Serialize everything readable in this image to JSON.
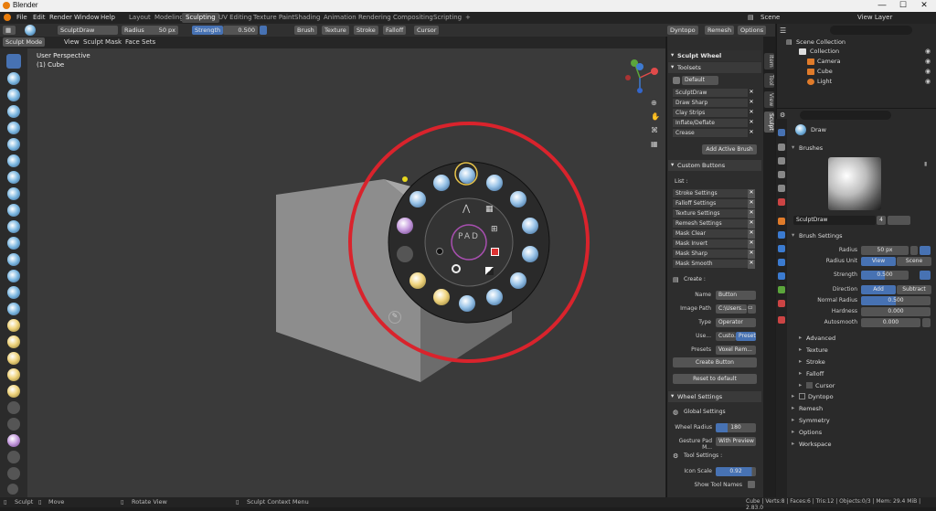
{
  "window": {
    "title": "Blender",
    "controls": [
      "—",
      "☐",
      "✕"
    ]
  },
  "menu": [
    "File",
    "Edit",
    "Render",
    "Window",
    "Help"
  ],
  "workspaces": [
    "Layout",
    "Modeling",
    "Sculpting",
    "UV Editing",
    "Texture Paint",
    "Shading",
    "Animation",
    "Rendering",
    "Compositing",
    "Scripting",
    "+"
  ],
  "active_workspace": "Sculpting",
  "scene": {
    "label": "Scene",
    "view_layer": "View Layer"
  },
  "header": {
    "brush_name": "SculptDraw",
    "radius_label": "Radius",
    "radius_value": "50 px",
    "strength_label": "Strength",
    "strength_value": "0.500",
    "dropdowns": [
      "Brush",
      "Texture",
      "Stroke",
      "Falloff",
      "Cursor"
    ],
    "dyntopo": "Dyntopo",
    "remesh": "Remesh",
    "options": "Options"
  },
  "subheader": {
    "mode": "Sculpt Mode",
    "items": [
      "View",
      "Sculpt",
      "Mask",
      "Face Sets"
    ]
  },
  "viewport": {
    "perspective": "User Perspective",
    "object": "(1) Cube",
    "pad_label": "PAD"
  },
  "sidebar_tabs": [
    "Item",
    "Tool",
    "View",
    "Sculpt"
  ],
  "sculpt_wheel": {
    "title": "Sculpt Wheel",
    "toolsets_label": "Toolsets",
    "toolset_default": "Default",
    "toolset_items": [
      "SculptDraw",
      "Draw Sharp",
      "Clay Strips",
      "Inflate/Deflate",
      "Crease"
    ],
    "add_active_brush": "Add Active Brush",
    "custom_buttons_label": "Custom Buttons",
    "list_label": "List :",
    "list_items": [
      "Stroke Settings",
      "Falloff Settings",
      "Texture Settings",
      "Remesh Settings",
      "Mask Clear",
      "Mask Invert",
      "Mask Sharp",
      "Mask Smooth"
    ],
    "create_label": "Create :",
    "name_label": "Name",
    "name_value": "Button",
    "image_path_label": "Image Path",
    "image_path_value": "C:\\Users...",
    "type_label": "Type",
    "type_value": "Operator",
    "use_label": "Use...",
    "use_custom": "Custo...",
    "use_preset": "Preset",
    "presets_label": "Presets",
    "presets_value": "Voxel Rem...",
    "create_button": "Create Button",
    "reset_button": "Reset to default",
    "wheel_settings_label": "Wheel Settings",
    "global_settings_label": "Global Settings",
    "wheel_radius_label": "Wheel Radius",
    "wheel_radius_value": "180",
    "gesture_pad_label": "Gesture Pad M...",
    "gesture_pad_value": "With Preview",
    "tool_settings_label": "Tool Settings :",
    "icon_scale_label": "Icon Scale",
    "icon_scale_value": "0.92",
    "show_tool_names": "Show Tool Names"
  },
  "outliner": {
    "root": "Scene Collection",
    "items": [
      {
        "name": "Collection"
      },
      {
        "name": "Camera"
      },
      {
        "name": "Cube"
      },
      {
        "name": "Light"
      }
    ]
  },
  "properties": {
    "tool_name": "Draw",
    "brushes_label": "Brushes",
    "brush_name": "SculptDraw",
    "brush_users": "4",
    "brush_settings_label": "Brush Settings",
    "radius_label": "Radius",
    "radius_value": "50 px",
    "radius_unit_label": "Radius Unit",
    "radius_unit_view": "View",
    "radius_unit_scene": "Scene",
    "strength_label": "Strength",
    "strength_value": "0.500",
    "direction_label": "Direction",
    "direction_add": "Add",
    "direction_subtract": "Subtract",
    "normal_radius_label": "Normal Radius",
    "normal_radius_value": "0.500",
    "hardness_label": "Hardness",
    "hardness_value": "0.000",
    "autosmooth_label": "Autosmooth",
    "autosmooth_value": "0.000",
    "subsections": [
      "Advanced",
      "Texture",
      "Stroke",
      "Falloff",
      "Cursor"
    ],
    "sections": [
      "Dyntopo",
      "Remesh",
      "Symmetry",
      "Options",
      "Workspace"
    ]
  },
  "status": {
    "left_items": [
      "Sculpt",
      "Move",
      "Rotate View",
      "Sculpt Context Menu"
    ],
    "stats": "Cube | Verts:8 | Faces:6 | Tris:12 | Objects:0/3 | Mem: 29.4 MiB | 2.83.0"
  },
  "colors": {
    "accent": "#4772b3",
    "ring": "#d9232c",
    "pad_ring": "#a84fb0",
    "ui_bg": "#303030"
  }
}
